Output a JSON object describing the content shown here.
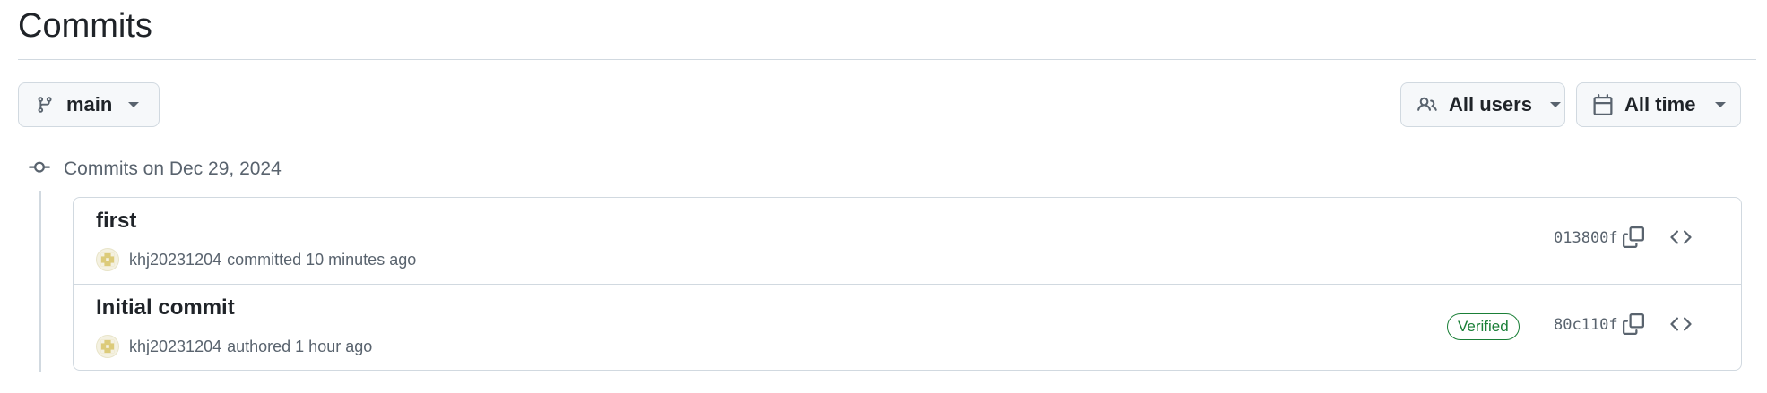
{
  "page": {
    "title": "Commits"
  },
  "filters": {
    "branch": {
      "label": "main",
      "icon": "git-branch-icon"
    },
    "users": {
      "label": "All users",
      "icon": "people-icon"
    },
    "time": {
      "label": "All time",
      "icon": "calendar-icon"
    }
  },
  "group": {
    "icon": "git-commit-icon",
    "label": "Commits on Dec 29, 2024"
  },
  "commits": [
    {
      "message": "first",
      "author": "khj20231204",
      "action": "committed",
      "time": "10 minutes ago",
      "verified": "",
      "sha": "013800f"
    },
    {
      "message": "Initial commit",
      "author": "khj20231204",
      "action": "authored",
      "time": "1 hour ago",
      "verified": "Verified",
      "sha": "80c110f"
    }
  ],
  "colors": {
    "text": "#1f2328",
    "muted": "#59636e",
    "border": "#d1d9e0",
    "button_bg": "#f6f8fa",
    "verified": "#1a7f37"
  }
}
